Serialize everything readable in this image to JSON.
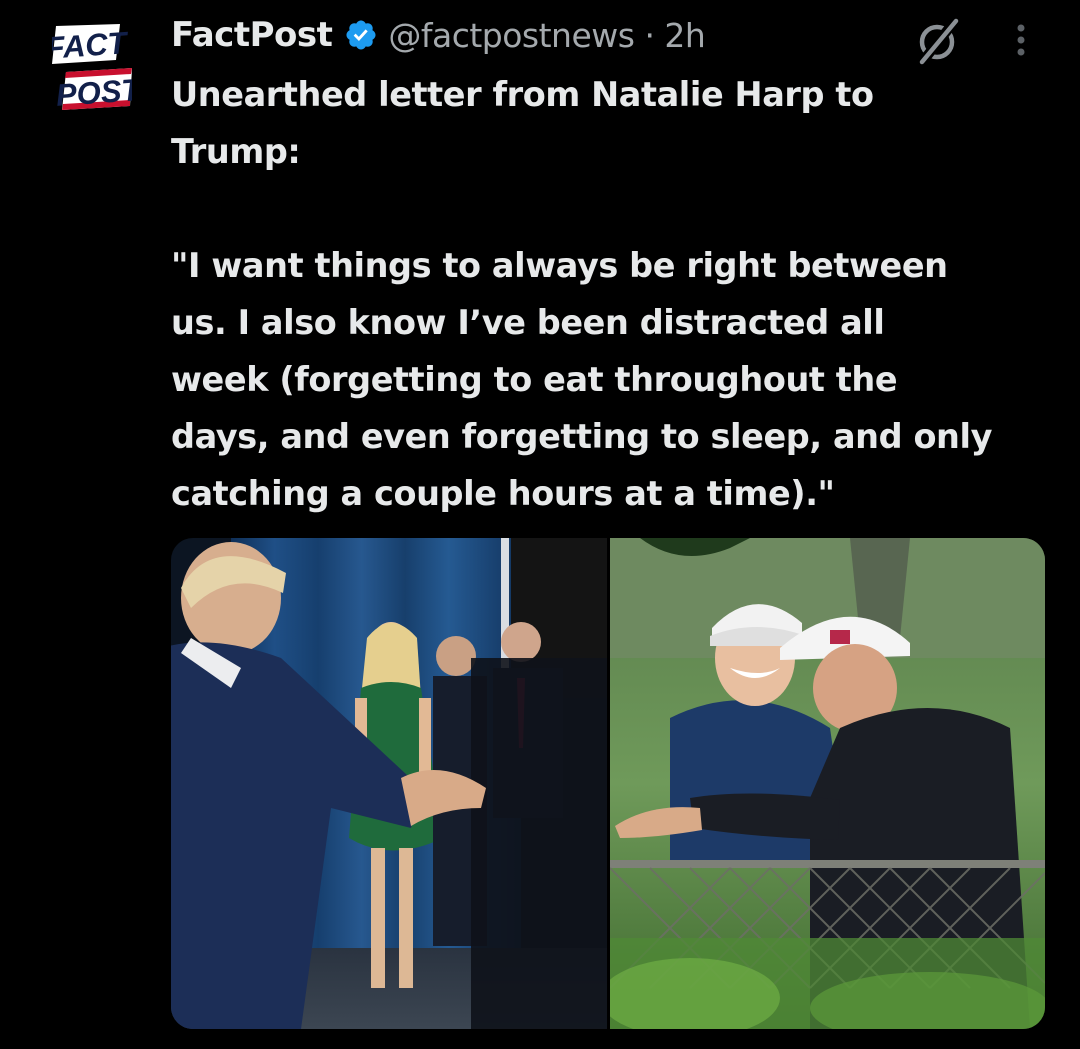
{
  "account": {
    "display_name": "FactPost",
    "handle_time": "@factpostnews · 2h",
    "avatar_text_top": "FACT",
    "avatar_text_bottom": "POST",
    "verified_color": "#1d9bf0"
  },
  "tweet": {
    "lines": [
      "Unearthed letter from Natalie Harp to",
      "Trump:",
      "",
      "\"I want things to always be right between",
      "us. I also know I’ve been distracted all",
      "week (forgetting to eat throughout the",
      "days, and even forgetting to sleep, and only",
      "catching a couple hours at a time).\""
    ]
  },
  "media": {
    "photos": [
      {
        "icon": "photo-rally-backstage"
      },
      {
        "icon": "photo-golf-course"
      }
    ]
  },
  "icons": {
    "grok": "grok-icon",
    "more": "more-options-icon",
    "verified": "verified-badge-icon"
  },
  "colors": {
    "background": "#000000",
    "text": "#e7e9ea",
    "secondary": "#a4a9ad",
    "accent": "#1d9bf0"
  }
}
